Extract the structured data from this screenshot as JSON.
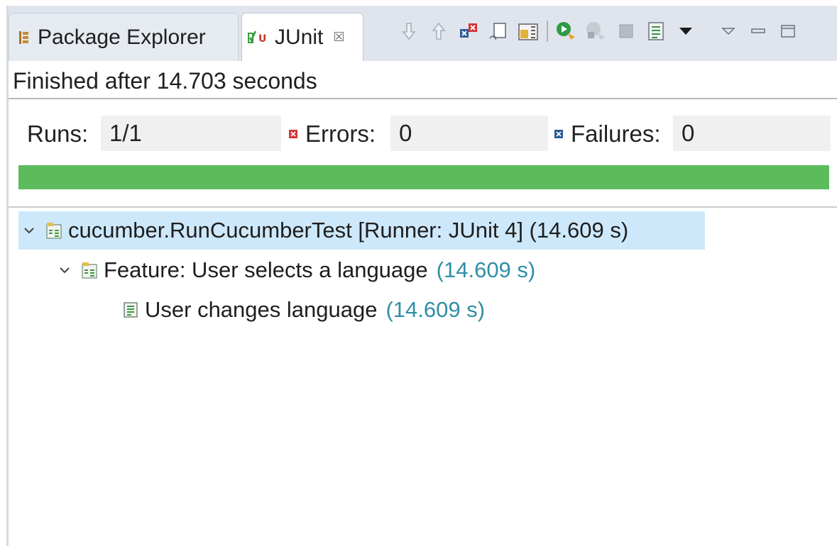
{
  "tabs": [
    {
      "label": "Package Explorer",
      "icon": "package-explorer-icon"
    },
    {
      "label": "JUnit",
      "icon": "junit-icon",
      "active": true,
      "close_glyph": "☒"
    }
  ],
  "toolbar": {
    "buttons": [
      "next-failure-icon",
      "previous-failure-icon",
      "show-failures-only-icon",
      "scroll-lock-icon",
      "layout-icon",
      "rerun-test-icon",
      "rerun-failed-first-icon",
      "stop-icon",
      "test-run-history-icon",
      "view-menu-icon"
    ],
    "window": [
      "view-menu-triangle-icon",
      "minimize-icon",
      "maximize-icon"
    ]
  },
  "status": {
    "text": "Finished after 14.703 seconds"
  },
  "counters": {
    "runs_label": "Runs:",
    "runs_value": "1/1",
    "errors_label": "Errors:",
    "errors_value": "0",
    "failures_label": "Failures:",
    "failures_value": "0"
  },
  "progress": {
    "fraction": 1.0,
    "color": "#5cbb5c"
  },
  "tree": [
    {
      "label": "cucumber.RunCucumberTest [Runner: JUnit 4] (14.609 s)",
      "time": "",
      "expanded": true,
      "selected": true
    },
    {
      "label": "Feature: User selects a language",
      "time": "(14.609 s)",
      "expanded": true
    },
    {
      "label": "User changes language",
      "time": "(14.609 s)"
    }
  ],
  "colors": {
    "accent_time": "#2f8fa6",
    "selection": "#cde8fa",
    "pass": "#5cbb5c"
  }
}
